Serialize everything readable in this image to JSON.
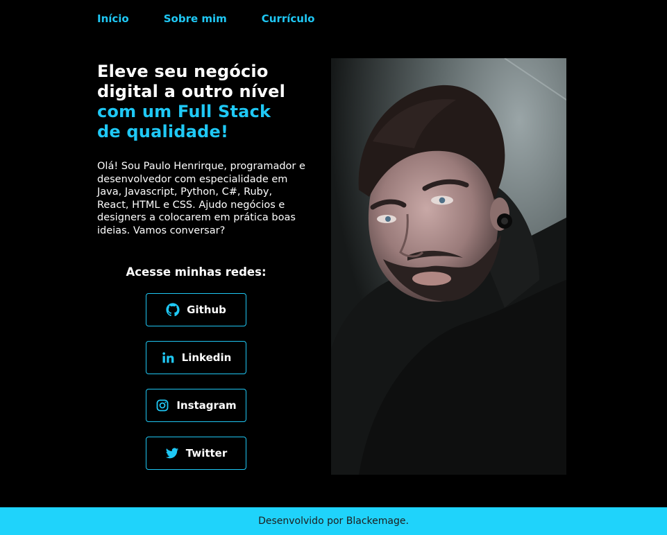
{
  "nav": {
    "items": [
      "Início",
      "Sobre mim",
      "Currículo"
    ]
  },
  "hero": {
    "headline_white": [
      "Eleve seu negócio",
      "digital a outro nível"
    ],
    "headline_cyan": [
      "com um Full Stack",
      "de qualidade!"
    ],
    "intro": "Olá! Sou Paulo Henrirque, programador e desenvolvedor com especialidade em Java, Javascript, Python, C#, Ruby, React, HTML e CSS. Ajudo negócios e designers a colocarem em prática boas ideias. Vamos conversar?"
  },
  "social": {
    "title": "Acesse minhas redes:",
    "buttons": [
      {
        "label": "Github",
        "icon": "github-icon"
      },
      {
        "label": "Linkedin",
        "icon": "linkedin-icon"
      },
      {
        "label": "Instagram",
        "icon": "instagram-icon"
      },
      {
        "label": "Twitter",
        "icon": "twitter-icon"
      }
    ]
  },
  "photo": {
    "alt": "profile-photo"
  },
  "footer": {
    "text": "Desenvolvido por Blackemage."
  },
  "colors": {
    "accent": "#1fc8f5",
    "footer_bg": "#1fd3fb",
    "background": "#000000"
  }
}
